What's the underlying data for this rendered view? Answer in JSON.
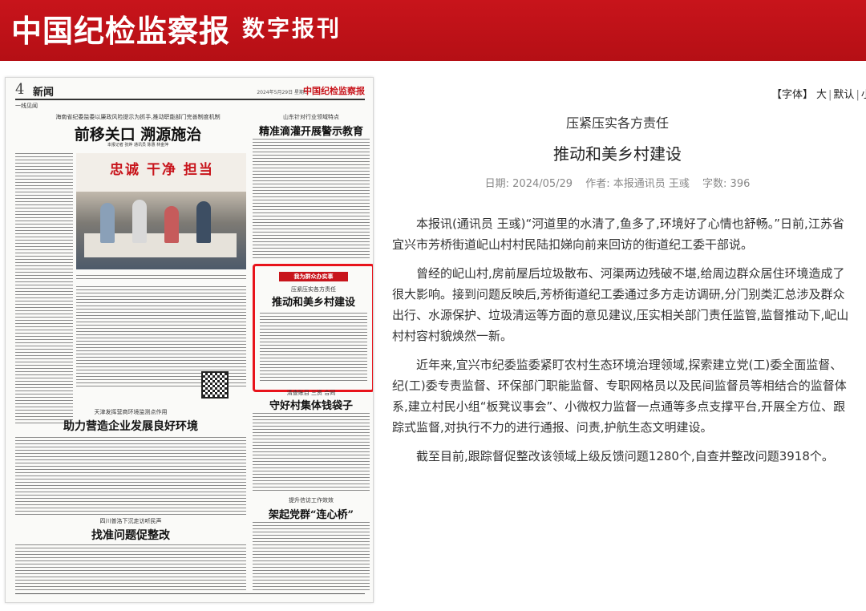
{
  "header": {
    "brand": "中国纪检监察报",
    "subtitle": "数字报刊"
  },
  "newspaper": {
    "page_number": "4",
    "section": "新闻",
    "date": "2024年5月29日  星期三",
    "logo": "中国纪检监察报",
    "column_label": "一线见闻",
    "story1_kicker": "海南省纪委监委以廉政风险提示为抓手,推动职能部门完善制度机制",
    "story1_headline": "前移关口  溯源施治",
    "story1_byline": "本报记者 张烨 通讯员 陈惠 林金萍",
    "photo_banner": "忠诚  干净  担当",
    "story2_kicker": "山东针对行业领域特点",
    "story2_headline": "精准滴灌开展警示教育",
    "box_label": "我为群众办实事",
    "box_kicker": "压紧压实各方责任",
    "box_headline": "推动和美乡村建设",
    "story3_kicker": "清查账目 三资 合同",
    "story3_headline": "守好村集体钱袋子",
    "story4_kicker": "天津发挥营商环境监测点作用",
    "story4_headline": "助力营造企业发展良好环境",
    "story5_kicker": "提升信访工作效效",
    "story5_headline": "架起党群“连心桥”",
    "story6_kicker": "四川普洛下沉走访听民声",
    "story6_headline": "找准问题促整改"
  },
  "fontbar": {
    "label": "【字体】",
    "large": "大",
    "default": "默认",
    "small": "小"
  },
  "article": {
    "subtitle": "压紧压实各方责任",
    "title": "推动和美乡村建设",
    "date": "日期:  2024/05/29",
    "author": "作者:  本报通讯员 王彧",
    "wordcount": "字数:  396",
    "paragraphs": [
      "本报讯(通讯员 王彧)“河道里的水清了,鱼多了,环境好了心情也舒畅。”日前,江苏省宜兴市芳桥街道屺山村村民陆扣娣向前来回访的街道纪工委干部说。",
      "曾经的屺山村,房前屋后垃圾散布、河渠两边残破不堪,给周边群众居住环境造成了很大影响。接到问题反映后,芳桥街道纪工委通过多方走访调研,分门别类汇总涉及群众出行、水源保护、垃圾清运等方面的意见建议,压实相关部门责任监管,监督推动下,屺山村村容村貌焕然一新。",
      "近年来,宜兴市纪委监委紧盯农村生态环境治理领域,探索建立党(工)委全面监督、纪(工)委专责监督、环保部门职能监督、专职网格员以及民间监督员等相结合的监督体系,建立村民小组“板凳议事会”、小微权力监督一点通等多点支撑平台,开展全方位、跟踪式监督,对执行不力的进行通报、问责,护航生态文明建设。",
      "截至目前,跟踪督促整改该领域上级反馈问题1280个,自查并整改问题3918个。"
    ]
  }
}
